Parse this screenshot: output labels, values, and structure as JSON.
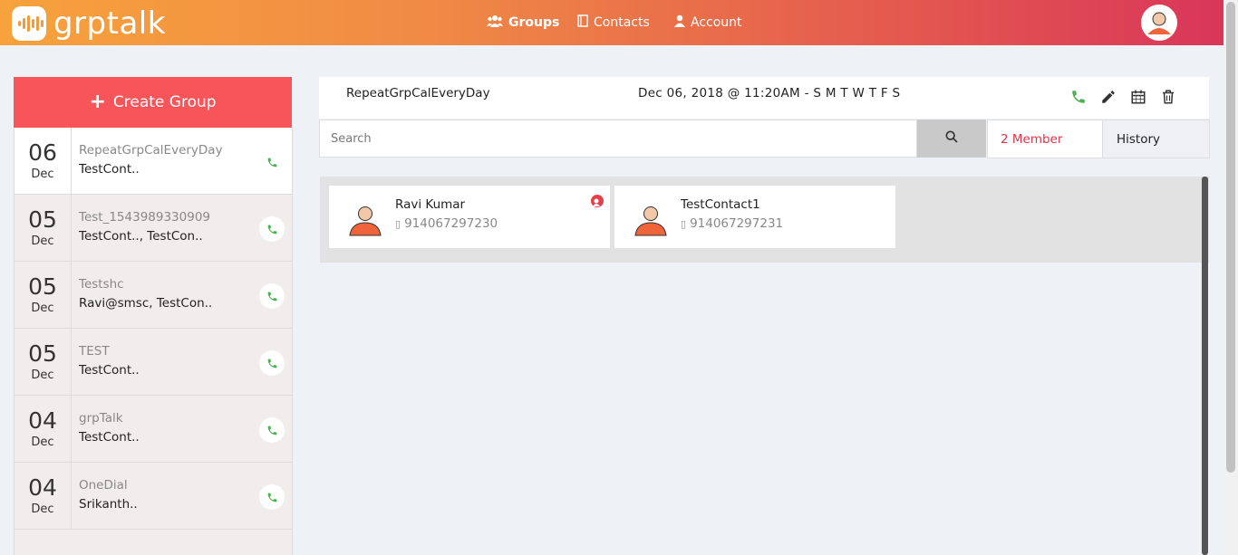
{
  "brand": {
    "name": "grptalk"
  },
  "nav": {
    "groups": "Groups",
    "contacts": "Contacts",
    "account": "Account"
  },
  "sidebar": {
    "create_label": "Create Group",
    "groups": [
      {
        "day": "06",
        "month": "Dec",
        "name": "RepeatGrpCalEveryDay",
        "members": "TestCont..",
        "active": true
      },
      {
        "day": "05",
        "month": "Dec",
        "name": "Test_1543989330909",
        "members": "TestCont.., TestCon..",
        "active": false
      },
      {
        "day": "05",
        "month": "Dec",
        "name": "Testshc",
        "members": "Ravi@smsc, TestCon..",
        "active": false
      },
      {
        "day": "05",
        "month": "Dec",
        "name": "TEST",
        "members": "TestCont..",
        "active": false
      },
      {
        "day": "04",
        "month": "Dec",
        "name": "grpTalk",
        "members": "TestCont..",
        "active": false
      },
      {
        "day": "04",
        "month": "Dec",
        "name": "OneDial",
        "members": "Srikanth..",
        "active": false
      }
    ]
  },
  "detail": {
    "title": "RepeatGrpCalEveryDay",
    "schedule": "Dec 06, 2018 @ 11:20AM - S M T W T F S",
    "search_placeholder": "Search",
    "member_tab": "2 Member",
    "history_tab": "History",
    "members": [
      {
        "name": "Ravi Kumar",
        "phone": "914067297230",
        "badge": true
      },
      {
        "name": "TestContact1",
        "phone": "914067297231",
        "badge": false
      }
    ]
  },
  "colors": {
    "accent": "#f7555a",
    "call_green": "#4caf50",
    "member_red": "#e0334b"
  },
  "icons": {
    "groups": "users-icon",
    "contacts": "book-icon",
    "account": "user-icon",
    "call": "phone-icon",
    "edit": "pencil-icon",
    "calendar": "calendar-icon",
    "delete": "trash-icon",
    "search": "search-icon",
    "mobile": "mobile-icon"
  }
}
